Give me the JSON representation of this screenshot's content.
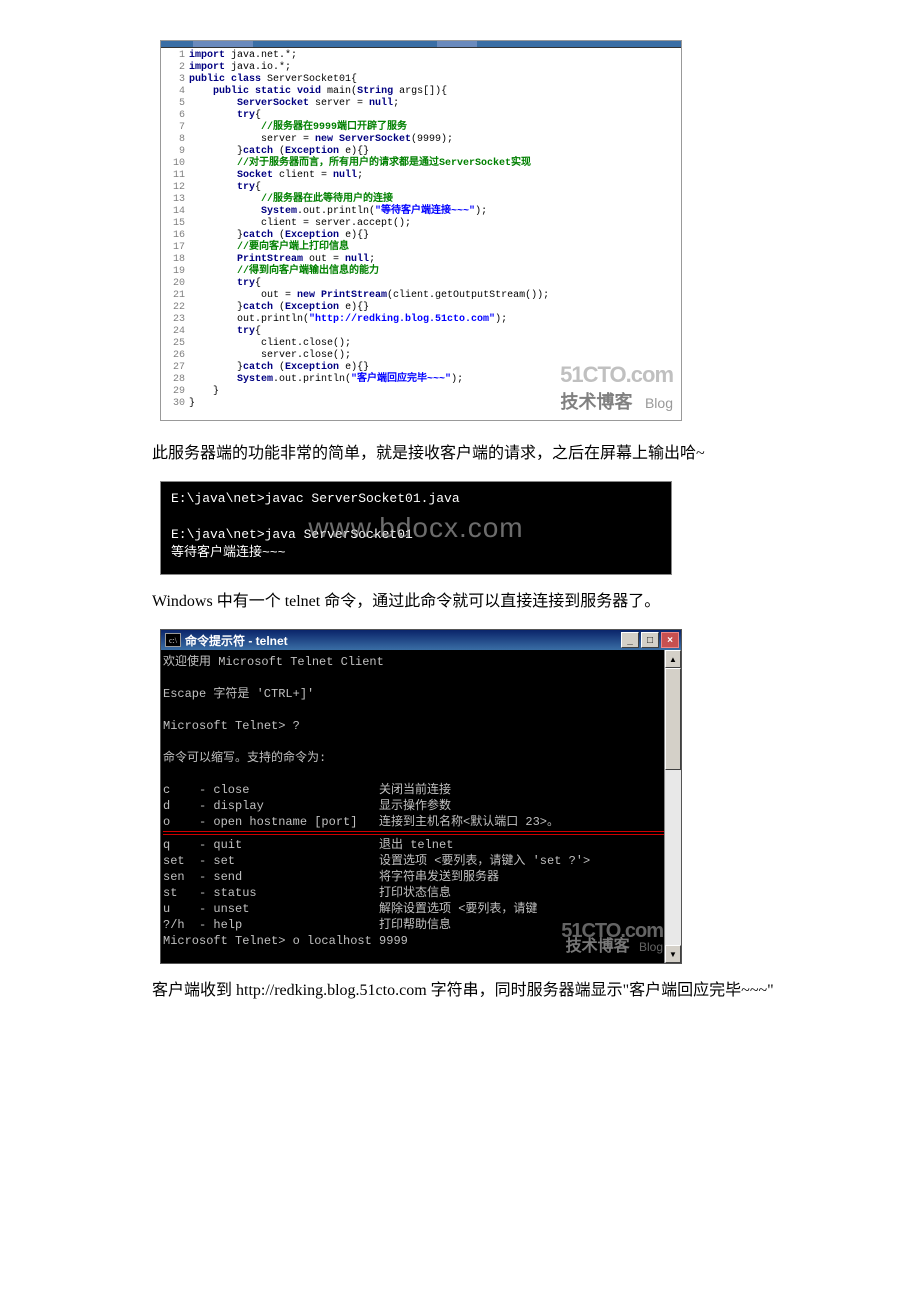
{
  "code": {
    "lines": [
      {
        "n": "1",
        "t": [
          {
            "c": "kw",
            "v": "import"
          },
          {
            "c": "op",
            "v": " java.net.*;"
          }
        ]
      },
      {
        "n": "2",
        "t": [
          {
            "c": "kw",
            "v": "import"
          },
          {
            "c": "op",
            "v": " java.io.*;"
          }
        ]
      },
      {
        "n": "3",
        "t": [
          {
            "c": "kw",
            "v": "public class "
          },
          {
            "c": "op",
            "v": "ServerSocket01{"
          }
        ]
      },
      {
        "n": "4",
        "t": [
          {
            "c": "op",
            "v": "    "
          },
          {
            "c": "kw",
            "v": "public static void "
          },
          {
            "c": "op",
            "v": "main("
          },
          {
            "c": "kw",
            "v": "String"
          },
          {
            "c": "op",
            "v": " args[]){"
          }
        ]
      },
      {
        "n": "5",
        "t": [
          {
            "c": "op",
            "v": "        "
          },
          {
            "c": "kw",
            "v": "ServerSocket"
          },
          {
            "c": "op",
            "v": " server = "
          },
          {
            "c": "kw",
            "v": "null"
          },
          {
            "c": "op",
            "v": ";"
          }
        ]
      },
      {
        "n": "6",
        "t": [
          {
            "c": "op",
            "v": "        "
          },
          {
            "c": "kw",
            "v": "try"
          },
          {
            "c": "op",
            "v": "{"
          }
        ]
      },
      {
        "n": "7",
        "t": [
          {
            "c": "op",
            "v": "            "
          },
          {
            "c": "cn",
            "v": "//服务器在9999端口开辟了服务"
          }
        ]
      },
      {
        "n": "8",
        "t": [
          {
            "c": "op",
            "v": "            server = "
          },
          {
            "c": "kw",
            "v": "new ServerSocket"
          },
          {
            "c": "op",
            "v": "(9999);"
          }
        ]
      },
      {
        "n": "9",
        "t": [
          {
            "c": "op",
            "v": "        }"
          },
          {
            "c": "kw",
            "v": "catch"
          },
          {
            "c": "op",
            "v": " ("
          },
          {
            "c": "kw",
            "v": "Exception"
          },
          {
            "c": "op",
            "v": " e){}"
          }
        ]
      },
      {
        "n": "10",
        "t": [
          {
            "c": "op",
            "v": "        "
          },
          {
            "c": "cn",
            "v": "//对于服务器而言，所有用户的请求都是通过ServerSocket实现"
          }
        ]
      },
      {
        "n": "11",
        "t": [
          {
            "c": "op",
            "v": "        "
          },
          {
            "c": "kw",
            "v": "Socket"
          },
          {
            "c": "op",
            "v": " client = "
          },
          {
            "c": "kw",
            "v": "null"
          },
          {
            "c": "op",
            "v": ";"
          }
        ]
      },
      {
        "n": "12",
        "t": [
          {
            "c": "op",
            "v": "        "
          },
          {
            "c": "kw",
            "v": "try"
          },
          {
            "c": "op",
            "v": "{"
          }
        ]
      },
      {
        "n": "13",
        "t": [
          {
            "c": "op",
            "v": "            "
          },
          {
            "c": "cn",
            "v": "//服务器在此等待用户的连接"
          }
        ]
      },
      {
        "n": "14",
        "t": [
          {
            "c": "op",
            "v": "            "
          },
          {
            "c": "kw",
            "v": "System"
          },
          {
            "c": "op",
            "v": ".out.println("
          },
          {
            "c": "str",
            "v": "\"等待客户端连接~~~\""
          },
          {
            "c": "op",
            "v": ");"
          }
        ]
      },
      {
        "n": "15",
        "t": [
          {
            "c": "op",
            "v": "            client = server.accept();"
          }
        ]
      },
      {
        "n": "16",
        "t": [
          {
            "c": "op",
            "v": "        }"
          },
          {
            "c": "kw",
            "v": "catch"
          },
          {
            "c": "op",
            "v": " ("
          },
          {
            "c": "kw",
            "v": "Exception"
          },
          {
            "c": "op",
            "v": " e){}"
          }
        ]
      },
      {
        "n": "17",
        "t": [
          {
            "c": "op",
            "v": "        "
          },
          {
            "c": "cn",
            "v": "//要向客户端上打印信息"
          }
        ]
      },
      {
        "n": "18",
        "t": [
          {
            "c": "op",
            "v": "        "
          },
          {
            "c": "kw",
            "v": "PrintStream"
          },
          {
            "c": "op",
            "v": " out = "
          },
          {
            "c": "kw",
            "v": "null"
          },
          {
            "c": "op",
            "v": ";"
          }
        ]
      },
      {
        "n": "19",
        "t": [
          {
            "c": "op",
            "v": "        "
          },
          {
            "c": "cn",
            "v": "//得到向客户端输出信息的能力"
          }
        ]
      },
      {
        "n": "20",
        "t": [
          {
            "c": "op",
            "v": "        "
          },
          {
            "c": "kw",
            "v": "try"
          },
          {
            "c": "op",
            "v": "{"
          }
        ]
      },
      {
        "n": "21",
        "t": [
          {
            "c": "op",
            "v": "            out = "
          },
          {
            "c": "kw",
            "v": "new PrintStream"
          },
          {
            "c": "op",
            "v": "(client.getOutputStream());"
          }
        ]
      },
      {
        "n": "22",
        "t": [
          {
            "c": "op",
            "v": "        }"
          },
          {
            "c": "kw",
            "v": "catch"
          },
          {
            "c": "op",
            "v": " ("
          },
          {
            "c": "kw",
            "v": "Exception"
          },
          {
            "c": "op",
            "v": " e){}"
          }
        ]
      },
      {
        "n": "23",
        "t": [
          {
            "c": "op",
            "v": "        out.println("
          },
          {
            "c": "str",
            "v": "\"http://redking.blog.51cto.com\""
          },
          {
            "c": "op",
            "v": ");"
          }
        ]
      },
      {
        "n": "24",
        "t": [
          {
            "c": "op",
            "v": "        "
          },
          {
            "c": "kw",
            "v": "try"
          },
          {
            "c": "op",
            "v": "{"
          }
        ]
      },
      {
        "n": "25",
        "t": [
          {
            "c": "op",
            "v": "            client.close();"
          }
        ]
      },
      {
        "n": "26",
        "t": [
          {
            "c": "op",
            "v": "            server.close();"
          }
        ]
      },
      {
        "n": "27",
        "t": [
          {
            "c": "op",
            "v": "        }"
          },
          {
            "c": "kw",
            "v": "catch"
          },
          {
            "c": "op",
            "v": " ("
          },
          {
            "c": "kw",
            "v": "Exception"
          },
          {
            "c": "op",
            "v": " e){}"
          }
        ]
      },
      {
        "n": "28",
        "t": [
          {
            "c": "op",
            "v": "        "
          },
          {
            "c": "kw",
            "v": "System"
          },
          {
            "c": "op",
            "v": ".out.println("
          },
          {
            "c": "str",
            "v": "\"客户端回应完毕~~~\""
          },
          {
            "c": "op",
            "v": ");"
          }
        ]
      },
      {
        "n": "29",
        "t": [
          {
            "c": "op",
            "v": "    }"
          }
        ]
      },
      {
        "n": "30",
        "t": [
          {
            "c": "op",
            "v": "}"
          }
        ]
      }
    ],
    "watermark_line1": "51CTO.com",
    "watermark_line2": "技术博客",
    "watermark_blog": "Blog"
  },
  "para1": "此服务器端的功能非常的简单，就是接收客户端的请求，之后在屏幕上输出哈~",
  "term1": {
    "lines": [
      "E:\\java\\net>javac ServerSocket01.java",
      "",
      "E:\\java\\net>java ServerSocket01",
      "等待客户端连接~~~"
    ],
    "watermark": "www.bdocx.com"
  },
  "para2": "Windows 中有一个 telnet 命令，通过此命令就可以直接连接到服务器了。",
  "cmd": {
    "title_prefix": "命令提示符 - telnet",
    "icon_text": "c:\\",
    "min": "_",
    "max": "□",
    "close": "×",
    "up": "▲",
    "down": "▼",
    "body": {
      "welcome": "欢迎使用 Microsoft Telnet Client",
      "escape": "Escape 字符是 'CTRL+]'",
      "prompt1": "Microsoft Telnet> ?",
      "help_header": "命令可以缩写。支持的命令为:",
      "rows_top": [
        {
          "a": "c",
          "b": "- close",
          "c": "关闭当前连接"
        },
        {
          "a": "d",
          "b": "- display",
          "c": "显示操作参数"
        },
        {
          "a": "o",
          "b": "- open hostname [port]",
          "c": "连接到主机名称<默认端口 23>。"
        }
      ],
      "rows_bottom": [
        {
          "a": "q",
          "b": "- quit",
          "c": "退出 telnet"
        },
        {
          "a": "set",
          "b": "- set",
          "c": "设置选项 <要列表，请键入 'set ?'>"
        },
        {
          "a": "sen",
          "b": "- send",
          "c": "将字符串发送到服务器"
        },
        {
          "a": "st",
          "b": "- status",
          "c": "打印状态信息"
        },
        {
          "a": "u",
          "b": "- unset",
          "c": "解除设置选项 <要列表，请键"
        },
        {
          "a": "?/h",
          "b": "- help",
          "c": "打印帮助信息"
        }
      ],
      "prompt2": "Microsoft Telnet> o localhost 9999"
    },
    "watermark_line1": "51CTO.com",
    "watermark_line2": "技术博客",
    "watermark_blog": "Blog"
  },
  "para3": "客户端收到 http://redking.blog.51cto.com 字符串，同时服务器端显示\"客户端回应完毕~~~\""
}
